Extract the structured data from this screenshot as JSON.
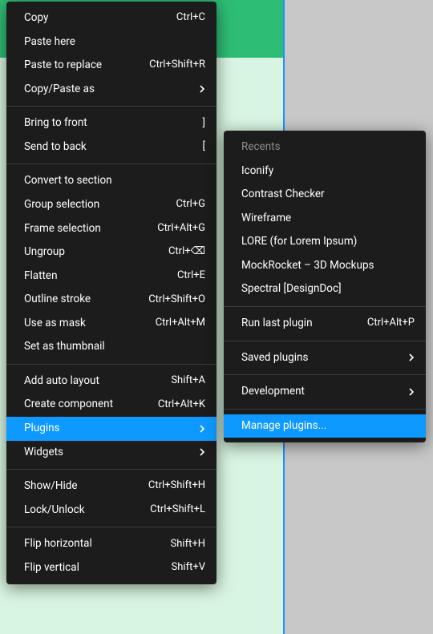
{
  "mainMenu": {
    "groups": [
      [
        {
          "label": "Copy",
          "shortcut": "Ctrl+C",
          "hasSubmenu": false
        },
        {
          "label": "Paste here",
          "shortcut": "",
          "hasSubmenu": false
        },
        {
          "label": "Paste to replace",
          "shortcut": "Ctrl+Shift+R",
          "hasSubmenu": false
        },
        {
          "label": "Copy/Paste as",
          "shortcut": "",
          "hasSubmenu": true
        }
      ],
      [
        {
          "label": "Bring to front",
          "shortcut": "]",
          "hasSubmenu": false
        },
        {
          "label": "Send to back",
          "shortcut": "[",
          "hasSubmenu": false
        }
      ],
      [
        {
          "label": "Convert to section",
          "shortcut": "",
          "hasSubmenu": false
        },
        {
          "label": "Group selection",
          "shortcut": "Ctrl+G",
          "hasSubmenu": false
        },
        {
          "label": "Frame selection",
          "shortcut": "Ctrl+Alt+G",
          "hasSubmenu": false
        },
        {
          "label": "Ungroup",
          "shortcut": "Ctrl+⌫",
          "hasSubmenu": false
        },
        {
          "label": "Flatten",
          "shortcut": "Ctrl+E",
          "hasSubmenu": false
        },
        {
          "label": "Outline stroke",
          "shortcut": "Ctrl+Shift+O",
          "hasSubmenu": false
        },
        {
          "label": "Use as mask",
          "shortcut": "Ctrl+Alt+M",
          "hasSubmenu": false
        },
        {
          "label": "Set as thumbnail",
          "shortcut": "",
          "hasSubmenu": false
        }
      ],
      [
        {
          "label": "Add auto layout",
          "shortcut": "Shift+A",
          "hasSubmenu": false
        },
        {
          "label": "Create component",
          "shortcut": "Ctrl+Alt+K",
          "hasSubmenu": false
        },
        {
          "label": "Plugins",
          "shortcut": "",
          "hasSubmenu": true,
          "highlight": true
        },
        {
          "label": "Widgets",
          "shortcut": "",
          "hasSubmenu": true
        }
      ],
      [
        {
          "label": "Show/Hide",
          "shortcut": "Ctrl+Shift+H",
          "hasSubmenu": false
        },
        {
          "label": "Lock/Unlock",
          "shortcut": "Ctrl+Shift+L",
          "hasSubmenu": false
        }
      ],
      [
        {
          "label": "Flip horizontal",
          "shortcut": "Shift+H",
          "hasSubmenu": false
        },
        {
          "label": "Flip vertical",
          "shortcut": "Shift+V",
          "hasSubmenu": false
        }
      ]
    ]
  },
  "subMenu": {
    "recentsHeader": "Recents",
    "recents": [
      "Iconify",
      "Contrast Checker",
      "Wireframe",
      "LORE (for Lorem Ipsum)",
      "MockRocket – 3D Mockups",
      "Spectral [DesignDoc]"
    ],
    "runLastPlugin": {
      "label": "Run last plugin",
      "shortcut": "Ctrl+Alt+P"
    },
    "savedPlugins": {
      "label": "Saved plugins"
    },
    "development": {
      "label": "Development"
    },
    "managePlugins": {
      "label": "Manage plugins...",
      "highlight": true
    }
  }
}
